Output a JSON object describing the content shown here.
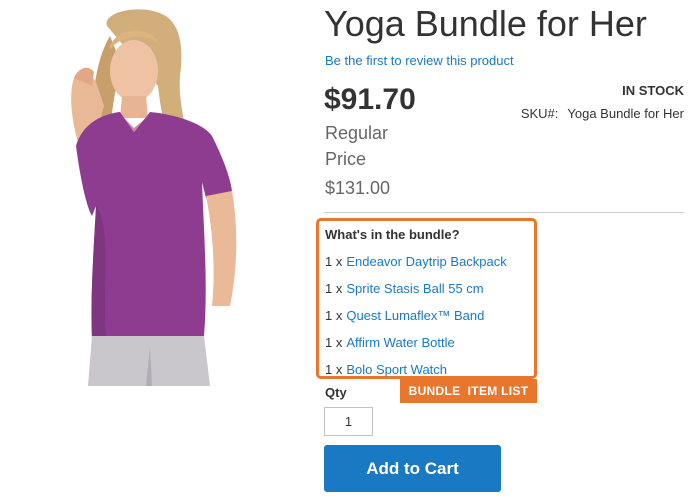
{
  "product": {
    "title": "Yoga Bundle for Her",
    "review_link": "Be the first to review this product",
    "price": "$91.70",
    "regular_label": "Regular Price",
    "regular_price": "$131.00",
    "stock": "In stock",
    "sku_label": "SKU#:",
    "sku_value": "Yoga Bundle for Her"
  },
  "bundle": {
    "heading": "What's in the bundle?",
    "items": [
      {
        "qty": "1 x",
        "name": "Endeavor Daytrip Backpack"
      },
      {
        "qty": "1 x",
        "name": "Sprite Stasis Ball 55 cm"
      },
      {
        "qty": "1 x",
        "name": "Quest Lumaflex™ Band"
      },
      {
        "qty": "1 x",
        "name": "Affirm Water Bottle"
      },
      {
        "qty": "1 x",
        "name": "Bolo Sport Watch"
      }
    ],
    "tag_label": "BUNDLE  ITEM LIST"
  },
  "cart": {
    "qty_label": "Qty",
    "qty_value": "1",
    "add_to_cart_label": "Add to Cart"
  },
  "colors": {
    "link": "#1979c3",
    "accent": "#e8762d",
    "button": "#1979c3",
    "shirt": "#8e3c8f"
  }
}
